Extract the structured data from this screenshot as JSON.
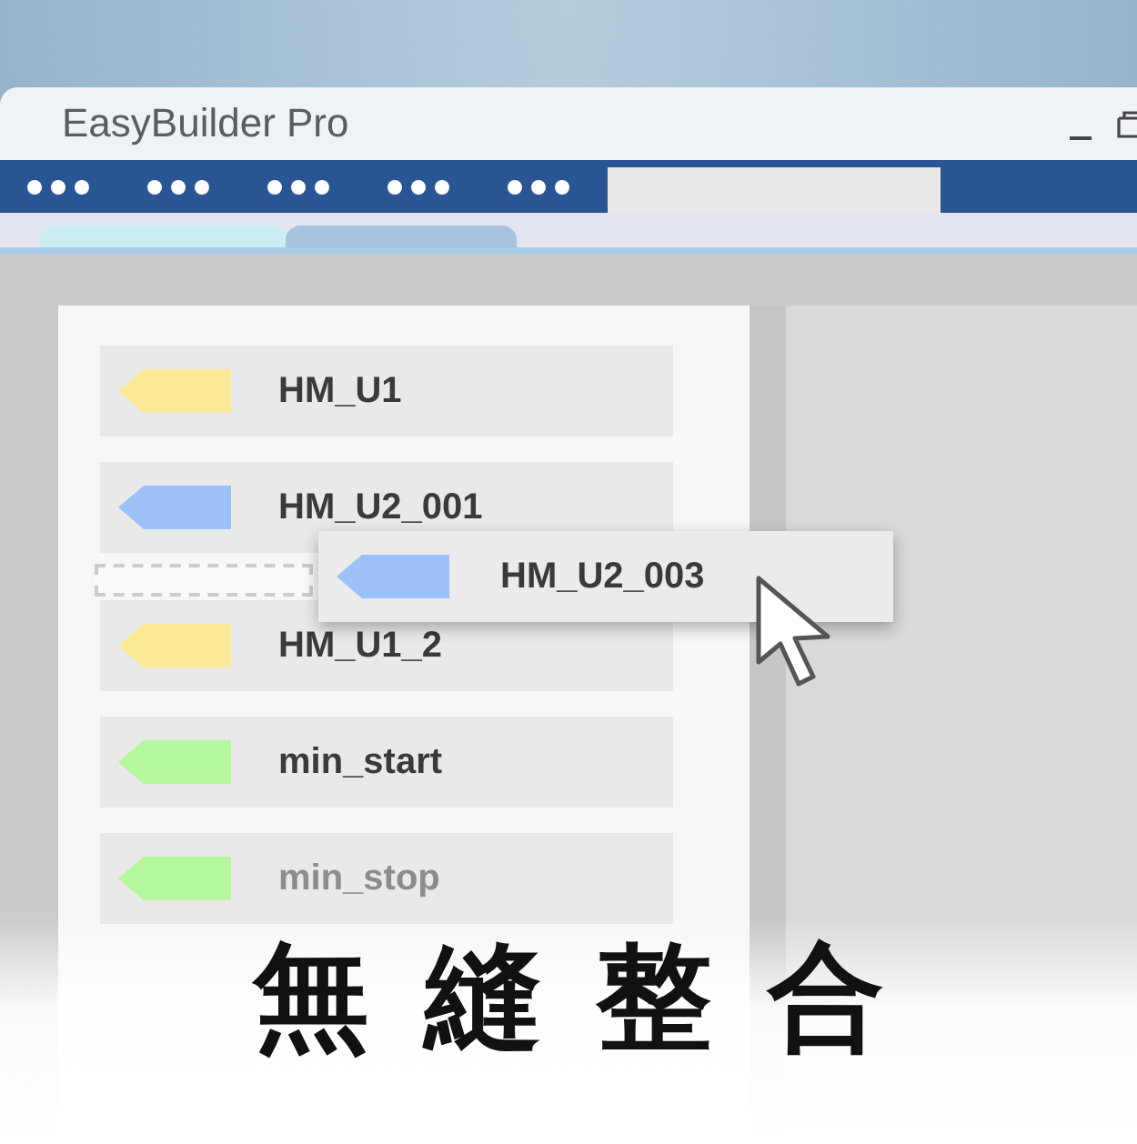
{
  "window": {
    "title": "EasyBuilder Pro"
  },
  "tags": [
    {
      "label": "HM_U1",
      "color": "#fbe996",
      "faded": false
    },
    {
      "label": "HM_U2_001",
      "color": "#9cc1f7",
      "faded": false
    },
    {
      "label": "HM_U1_2",
      "color": "#fbe996",
      "faded": false
    },
    {
      "label": "min_start",
      "color": "#b5f79c",
      "faded": false
    },
    {
      "label": "min_stop",
      "color": "#b5f79c",
      "faded": true
    }
  ],
  "dragged_tag": {
    "label": "HM_U2_003",
    "color": "#9cc1f7"
  },
  "caption": "無 縫 整 合"
}
